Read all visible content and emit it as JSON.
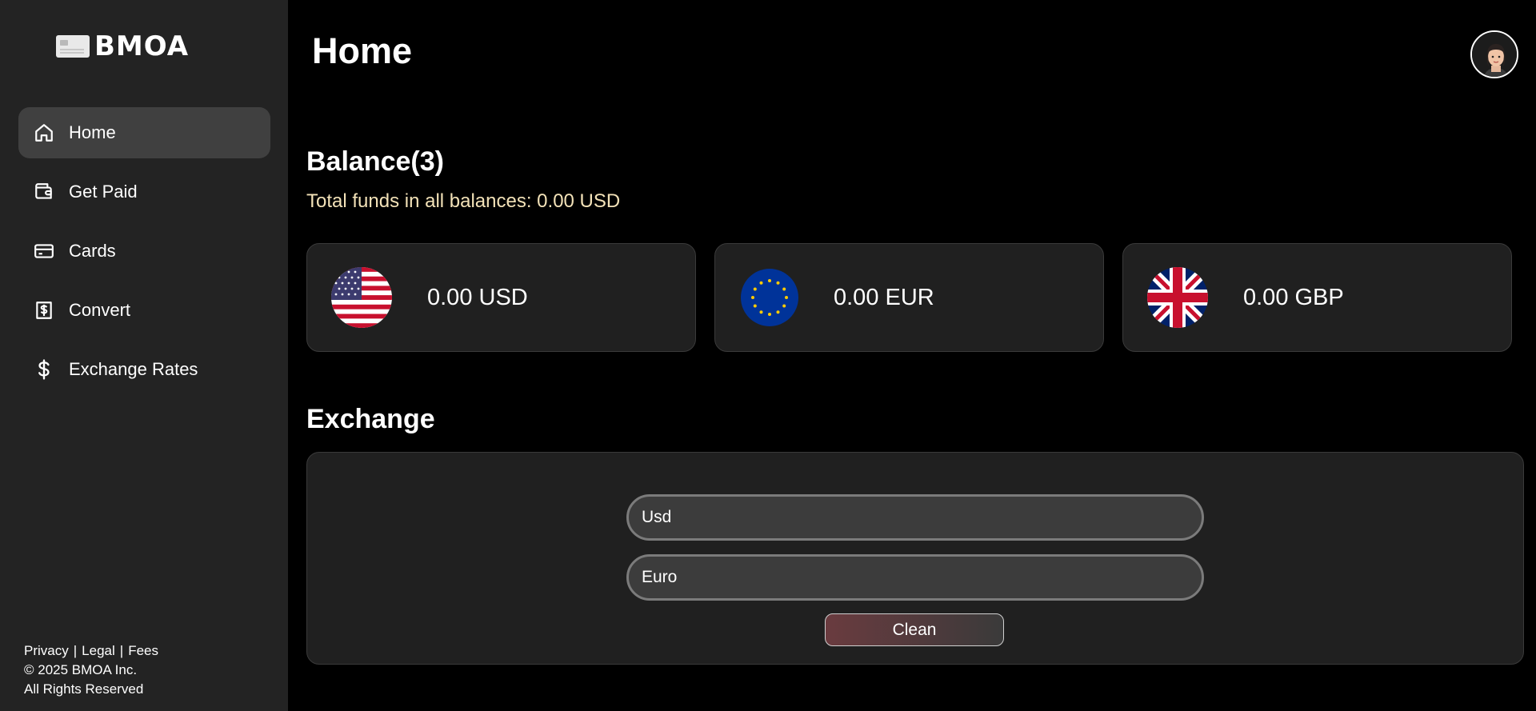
{
  "brand": {
    "logo_text": "BMOA"
  },
  "sidebar": {
    "items": [
      {
        "label": "Home",
        "icon": "home-icon",
        "active": true
      },
      {
        "label": "Get Paid",
        "icon": "wallet-icon"
      },
      {
        "label": "Cards",
        "icon": "credit-card-icon"
      },
      {
        "label": "Convert",
        "icon": "receipt-dollar-icon"
      },
      {
        "label": "Exchange Rates",
        "icon": "dollar-icon"
      }
    ],
    "footer": {
      "privacy": "Privacy",
      "legal": "Legal",
      "fees": "Fees",
      "separator": "|",
      "copyright": "© 2025 BMOA Inc.",
      "rights": "All Rights Reserved"
    }
  },
  "header": {
    "title": "Home",
    "avatar_icon": "user-avatar-icon"
  },
  "balance": {
    "title": "Balance(3)",
    "total": "Total funds in all balances: 0.00 USD",
    "cards": [
      {
        "value": "0.00 USD",
        "flag": "us-flag-icon"
      },
      {
        "value": "0.00 EUR",
        "flag": "eu-flag-icon"
      },
      {
        "value": "0.00 GBP",
        "flag": "uk-flag-icon"
      }
    ]
  },
  "exchange": {
    "title": "Exchange",
    "from_placeholder": "Usd",
    "to_placeholder": "Euro",
    "clean_label": "Clean"
  },
  "colors": {
    "background": "#000000",
    "sidebar": "#232323",
    "active_item": "#404040",
    "total_text": "#f3e2b8"
  }
}
